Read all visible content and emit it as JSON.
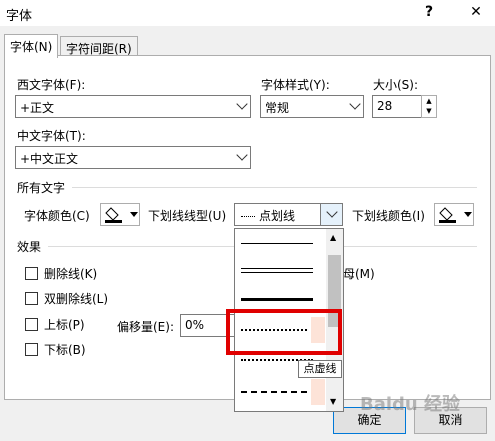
{
  "window": {
    "title": "字体",
    "help_label": "?",
    "close_label": "✕"
  },
  "tabs": [
    {
      "label": "字体(N)"
    },
    {
      "label": "字符间距(R)"
    }
  ],
  "western_font": {
    "label": "西文字体(F):",
    "value": "+正文"
  },
  "font_style": {
    "label": "字体样式(Y):",
    "value": "常规"
  },
  "font_size": {
    "label": "大小(S):",
    "value": "28"
  },
  "chinese_font": {
    "label": "中文字体(T):",
    "value": "+中文正文"
  },
  "all_text": {
    "section_label": "所有文字",
    "font_color_label": "字体颜色(C)",
    "underline_type_label": "下划线线型(U)",
    "underline_type_value": "点划线",
    "underline_color_label": "下划线颜色(I)"
  },
  "effects": {
    "section_label": "效果",
    "strikethrough": "删除线(K)",
    "double_strikethrough": "双删除线(L)",
    "superscript": "上标(P)",
    "subscript": "下标(B)",
    "offset_label": "偏移量(E):",
    "offset_value": "0%",
    "smallcaps_partial": "母(M)"
  },
  "dropdown": {
    "tooltip": "点虚线"
  },
  "buttons": {
    "ok": "确定",
    "cancel": "取消"
  },
  "watermark": "Baidu 经验",
  "colors": {
    "accent": "#0078d7",
    "highlight": "#e00000",
    "selected_item": "#fde3d8"
  }
}
